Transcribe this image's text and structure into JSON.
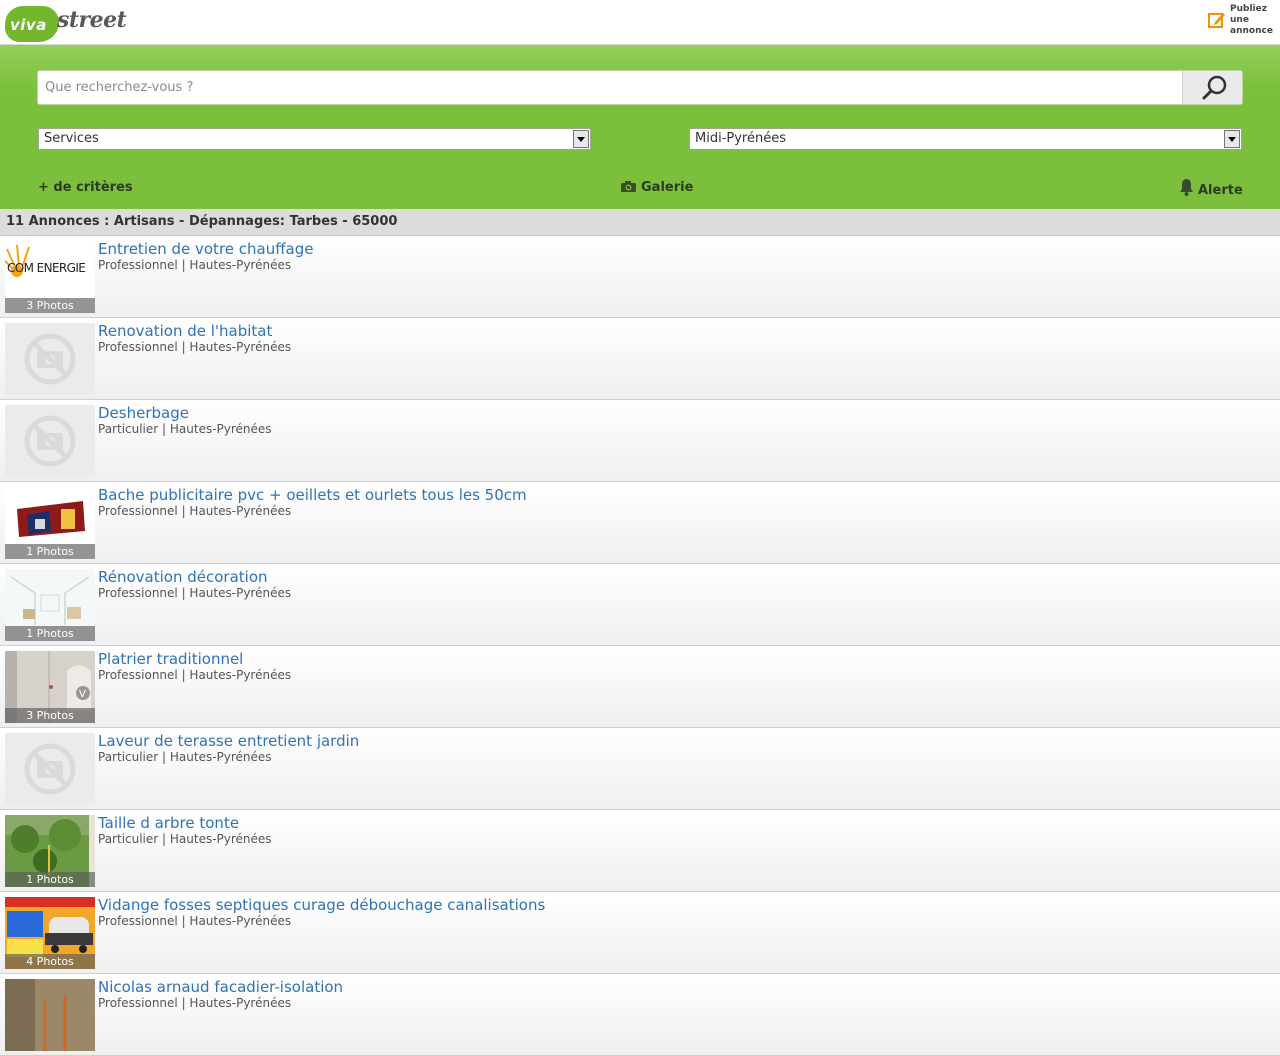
{
  "header": {
    "logo_viva": "viva",
    "logo_street": "street",
    "publish_lines": [
      "Publiez",
      "une",
      "annonce"
    ]
  },
  "search": {
    "placeholder": "Que recherchez-vous ?",
    "value": ""
  },
  "filters": {
    "category": "Services",
    "region": "Midi-Pyrénées"
  },
  "toolbar": {
    "criteria": "+ de critères",
    "gallery": "Galerie",
    "alert": "Alerte"
  },
  "results": {
    "summary": "11 Annonces : Artisans - Dépannages: Tarbes - 65000"
  },
  "items": [
    {
      "title": "Entretien de votre chauffage",
      "meta": "Professionnel | Hautes-Pyrénées",
      "photos": "3 Photos",
      "thumb": "com-energie-logo",
      "thumb_text": "COM ENERGIE"
    },
    {
      "title": "Renovation de l'habitat",
      "meta": "Professionnel | Hautes-Pyrénées",
      "photos": "",
      "thumb": "no-photo"
    },
    {
      "title": "Desherbage",
      "meta": "Particulier | Hautes-Pyrénées",
      "photos": "",
      "thumb": "no-photo"
    },
    {
      "title": "Bache publicitaire pvc + oeillets et ourlets tous les 50cm",
      "meta": "Professionnel | Hautes-Pyrénées",
      "photos": "1 Photos",
      "thumb": "banner-photo"
    },
    {
      "title": "Rénovation décoration",
      "meta": "Professionnel | Hautes-Pyrénées",
      "photos": "1 Photos",
      "thumb": "interior-photo"
    },
    {
      "title": "Platrier traditionnel",
      "meta": "Professionnel | Hautes-Pyrénées",
      "photos": "3 Photos",
      "thumb": "wall-photo"
    },
    {
      "title": "Laveur de terasse entretient jardin",
      "meta": "Particulier | Hautes-Pyrénées",
      "photos": "",
      "thumb": "no-photo"
    },
    {
      "title": "Taille d arbre tonte",
      "meta": "Particulier | Hautes-Pyrénées",
      "photos": "1 Photos",
      "thumb": "garden-photo"
    },
    {
      "title": "Vidange fosses septiques curage débouchage canalisations",
      "meta": "Professionnel | Hautes-Pyrénées",
      "photos": "4 Photos",
      "thumb": "flyer-photo"
    },
    {
      "title": "Nicolas arnaud facadier-isolation",
      "meta": "Professionnel | Hautes-Pyrénées",
      "photos": "",
      "thumb": "facade-photo"
    }
  ],
  "colors": {
    "brand_green": "#7bbf3c",
    "link_blue": "#2f73b7",
    "publish_orange": "#f39200"
  }
}
